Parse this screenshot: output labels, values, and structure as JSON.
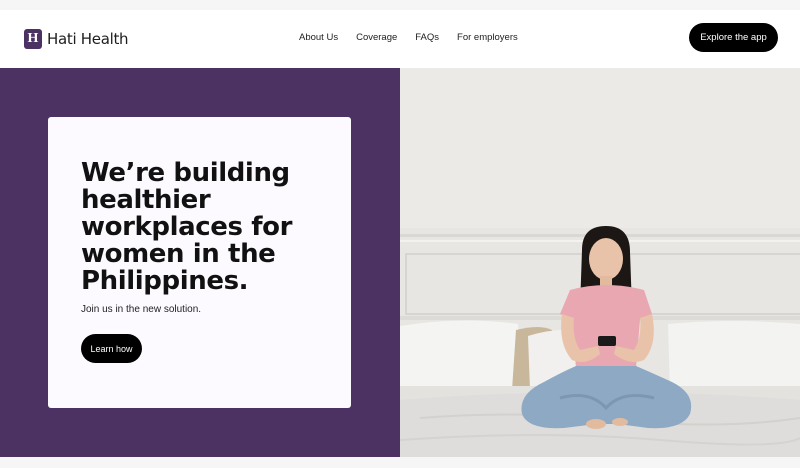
{
  "brand": {
    "name": "Hati Health",
    "mark": "H"
  },
  "nav": {
    "items": [
      "About Us",
      "Coverage",
      "FAQs",
      "For employers"
    ]
  },
  "header": {
    "cta_label": "Explore the app"
  },
  "hero": {
    "headline": "We’re building healthier workplaces for women in the Philippines.",
    "subtext": "Join us in the new solution.",
    "button_label": "Learn how",
    "image": "woman-using-phone-on-bed-photo"
  },
  "colors": {
    "brand_purple": "#4b3263",
    "button_black": "#000000",
    "card_bg": "#fcfaff"
  }
}
